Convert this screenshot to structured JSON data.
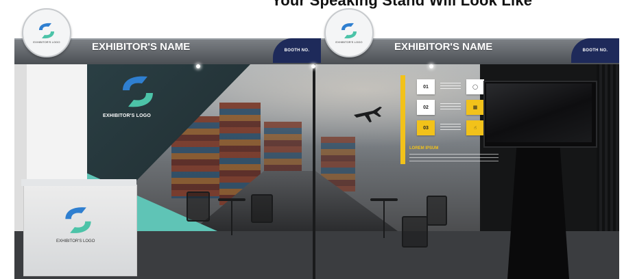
{
  "caption": {
    "text": "Your Speaking Stand Will Look Like"
  },
  "fascia": {
    "exhibitor_name_left": "EXHIBITOR'S NAME",
    "exhibitor_name_right": "EXHIBITOR'S NAME",
    "booth_no_left": "BOOTH NO.",
    "booth_no_right": "BOOTH NO.",
    "disc_label": "EXHIBITOR'S LOGO"
  },
  "wall": {
    "logo_label": "EXHIBITOR'S LOGO"
  },
  "infographic": {
    "steps": [
      "01",
      "02",
      "03"
    ],
    "heading": "LOREM IPSUM"
  },
  "counter": {
    "logo_label": "EXHIBITOR'S LOGO"
  },
  "colors": {
    "logo_blue": "#2f7fd0",
    "logo_teal": "#4cc3a8",
    "accent_yellow": "#f2c21a",
    "booth_tab_navy": "#1e2a5a"
  }
}
